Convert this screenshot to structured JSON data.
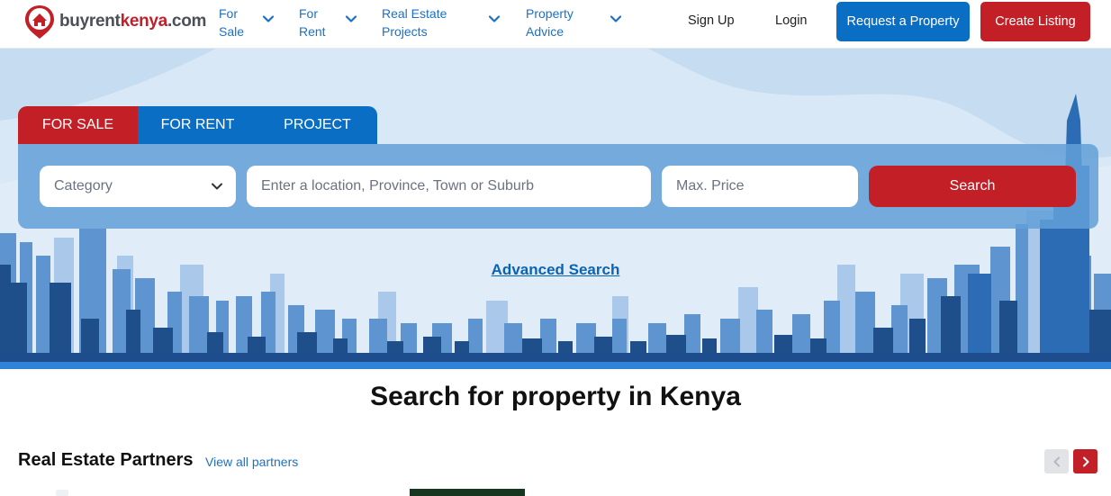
{
  "header": {
    "logo_prefix": "buyrent",
    "logo_accent": "kenya",
    "logo_suffix": ".com",
    "nav": [
      {
        "line1": "For",
        "line2": "Sale"
      },
      {
        "line1": "For",
        "line2": "Rent"
      },
      {
        "line1": "Real Estate",
        "line2": "Projects"
      },
      {
        "line1": "Property",
        "line2": "Advice"
      }
    ],
    "signup": "Sign Up",
    "login": "Login",
    "request_button": "Request a Property",
    "create_button": "Create Listing"
  },
  "search": {
    "tabs": [
      "FOR SALE",
      "FOR RENT",
      "PROJECT"
    ],
    "active_tab": "FOR SALE",
    "category_placeholder": "Category",
    "location_placeholder": "Enter a location, Province, Town or Suburb",
    "price_placeholder": "Max. Price",
    "search_button": "Search",
    "advanced_link": "Advanced Search"
  },
  "main": {
    "title": "Search for property in Kenya",
    "partners_title": "Real Estate Partners",
    "view_all": "View all partners"
  },
  "colors": {
    "brand_red": "#c31f27",
    "brand_blue": "#0a6ec4",
    "hero_bg": "#c6ddf1",
    "link_blue": "#1d71c2"
  }
}
